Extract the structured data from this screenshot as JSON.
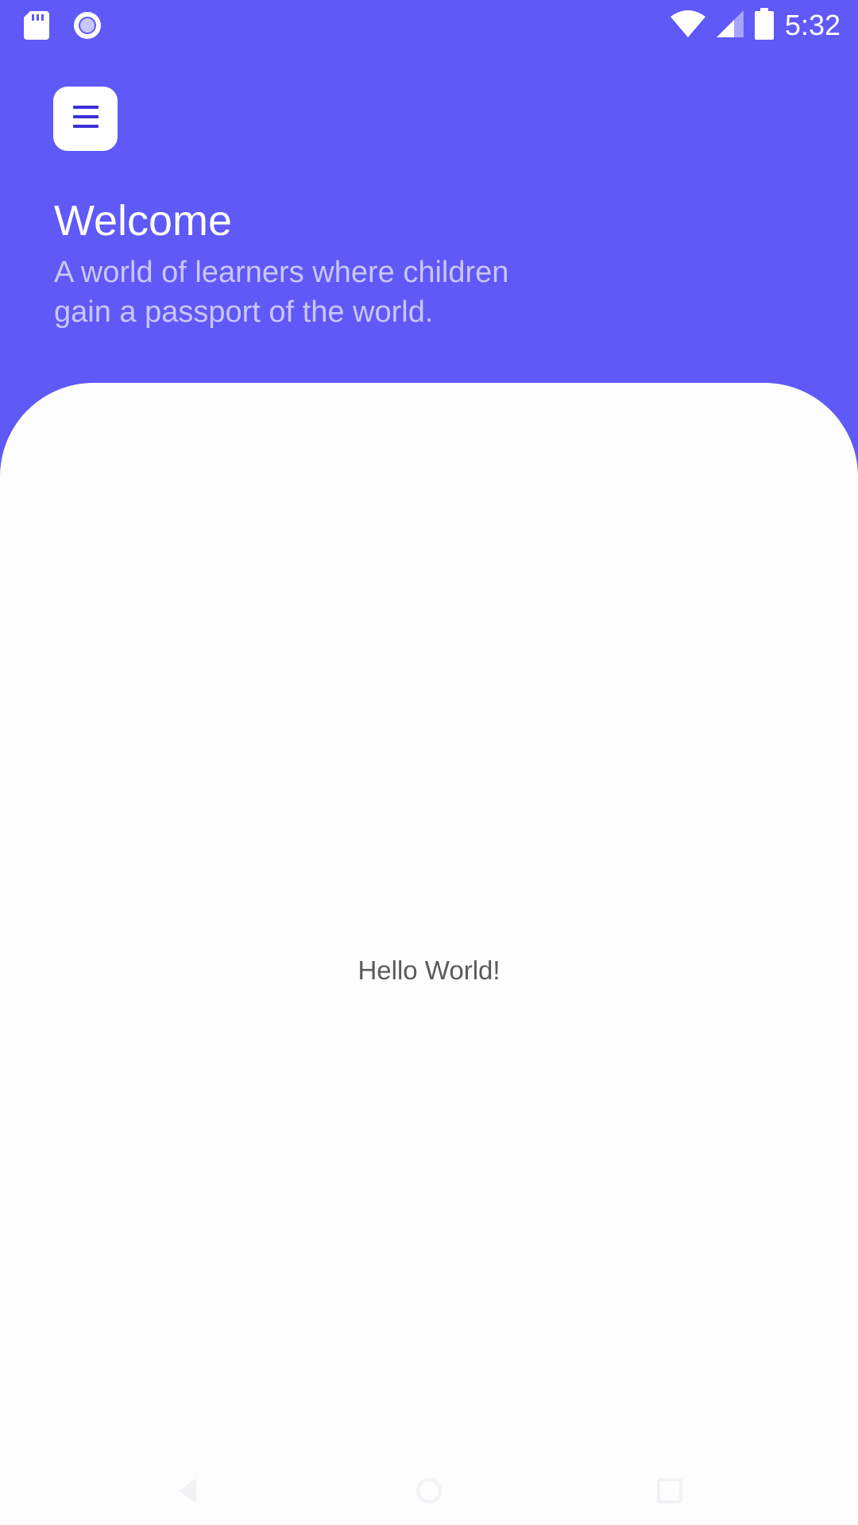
{
  "status_bar": {
    "time": "5:32",
    "icons": [
      "sd-card-icon",
      "sync-circle-icon",
      "wifi-icon",
      "cell-signal-icon",
      "battery-icon"
    ]
  },
  "header": {
    "menu_icon": "hamburger-menu-icon",
    "title": "Welcome",
    "subtitle": "A world of learners where children\n gain a passport of the world."
  },
  "content": {
    "message": "Hello World!"
  },
  "nav_bar": {
    "icons": [
      "back-icon",
      "home-icon",
      "recents-icon"
    ]
  },
  "colors": {
    "header_bg": "#5f59f7",
    "card_bg": "#fdfdfe",
    "menu_icon": "#3b2fd9",
    "subtitle": "#c9c6fb",
    "body_text": "#5b5b5b"
  }
}
